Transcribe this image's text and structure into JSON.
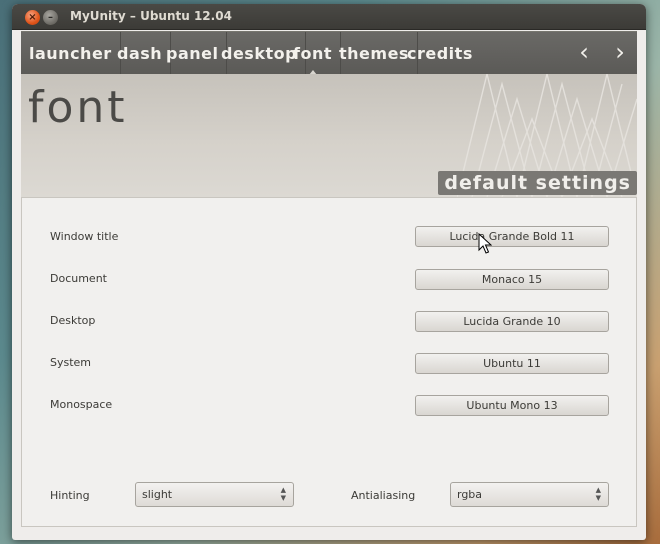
{
  "window": {
    "title": "MyUnity – Ubuntu 12.04"
  },
  "nav": {
    "items": [
      "launcher",
      "dash",
      "panel",
      "desktop",
      "font",
      "themes",
      "credits"
    ],
    "active": "font",
    "prev_glyph": "‹",
    "next_glyph": "›"
  },
  "page": {
    "title": "font",
    "defaults_button": "default settings"
  },
  "fonts": [
    {
      "label": "Window title",
      "value": "Lucida Grande Bold 11"
    },
    {
      "label": "Document",
      "value": "Monaco 15"
    },
    {
      "label": "Desktop",
      "value": "Lucida Grande 10"
    },
    {
      "label": "System",
      "value": "Ubuntu 11"
    },
    {
      "label": "Monospace",
      "value": "Ubuntu Mono 13"
    }
  ],
  "hinting": {
    "label": "Hinting",
    "value": "slight"
  },
  "antialiasing": {
    "label": "Antialiasing",
    "value": "rgba"
  },
  "colors": {
    "accent": "#e0541a",
    "titlebar": "#3c3b37",
    "nav": "#5f5e5b"
  }
}
